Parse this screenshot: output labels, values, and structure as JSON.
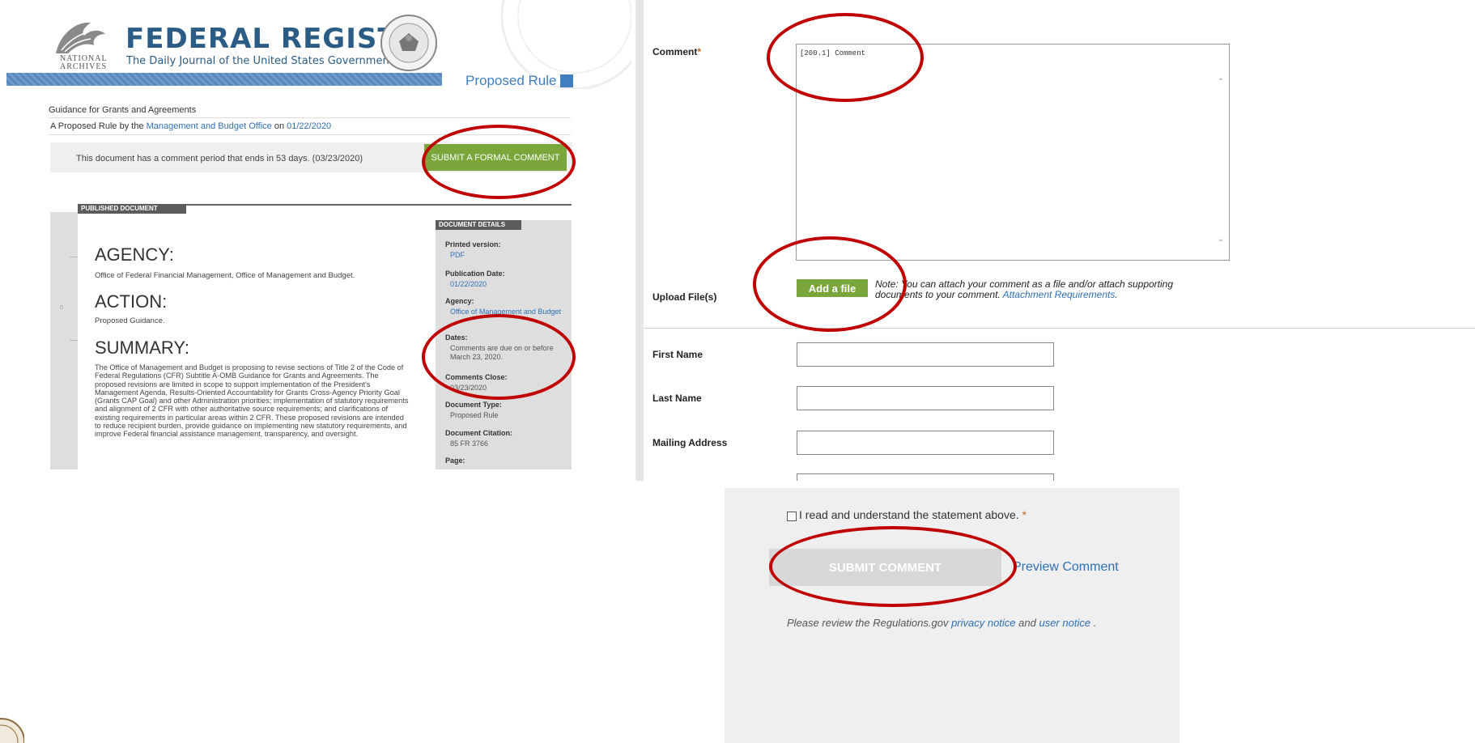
{
  "left": {
    "na_text": "NATIONAL\nARCHIVES",
    "title": "FEDERAL REGISTER",
    "subtitle": "The Daily Journal of the United States Government",
    "doc_type": "Proposed Rule",
    "doc_title": "Guidance for Grants and Agreements",
    "byline_prefix": "A Proposed Rule by the ",
    "byline_agency": "Management and Budget Office",
    "byline_on": " on ",
    "byline_date": "01/22/2020",
    "comment_period_text": "This document has a comment period that ends in 53 days. (03/23/2020)",
    "submit_formal_label": "SUBMIT A FORMAL COMMENT",
    "published_tab": "PUBLISHED DOCUMENT",
    "side_mark": "0",
    "agency_heading": "AGENCY:",
    "agency_text": "Office of Federal Financial Management, Office of Management and Budget.",
    "action_heading": "ACTION:",
    "action_text": "Proposed Guidance.",
    "summary_heading": "SUMMARY:",
    "summary_text": "The Office of Management and Budget is proposing to revise sections of Title 2 of the Code of Federal Regulations (CFR) Subtitle A-OMB Guidance for Grants and Agreements. The proposed revisions are limited in scope to support implementation of the President's Management Agenda, Results-Oriented Accountability for Grants Cross-Agency Priority Goal (Grants CAP Goal) and other Administration priorities; implementation of statutory requirements and alignment of 2 CFR with other authoritative source requirements; and clarifications of existing requirements in particular areas within 2 CFR. These proposed revisions are intended to reduce recipient burden, provide guidance on implementing new statutory requirements, and improve Federal financial assistance management, transparency, and oversight.",
    "details_tab": "DOCUMENT DETAILS",
    "details": [
      {
        "label": "Printed version:",
        "value": "PDF",
        "link": true
      },
      {
        "label": "Publication Date:",
        "value": "01/22/2020",
        "link": true
      },
      {
        "label": "Agency:",
        "value": "Office of Management and Budget",
        "link": true
      },
      {
        "label": "Dates:",
        "value": "Comments are due on or before March 23, 2020.",
        "link": false
      },
      {
        "label": "Comments Close:",
        "value": "03/23/2020",
        "link": false
      },
      {
        "label": "Document Type:",
        "value": "Proposed Rule",
        "link": false
      },
      {
        "label": "Document Citation:",
        "value": "85 FR 3766",
        "link": false
      },
      {
        "label": "Page:",
        "value": "",
        "link": false
      }
    ]
  },
  "right": {
    "comment_label": "Comment",
    "required_mark": "*",
    "comment_value": "[200.1] Comment",
    "upload_label": "Upload File(s)",
    "add_file_label": "Add a file",
    "note_prefix": "Note:",
    "note_text": " You can attach your comment as a file and/or attach supporting documents to your comment. ",
    "note_link": "Attachment Requirements",
    "note_end": ".",
    "first_name_label": "First Name",
    "last_name_label": "Last Name",
    "mailing_label": "Mailing Address"
  },
  "bottom": {
    "statement": "I read and understand the statement above.",
    "required_mark": "*",
    "submit_label": "SUBMIT COMMENT",
    "preview_label": "Preview Comment",
    "review_prefix": "Please review the Regulations.gov ",
    "privacy_link": "privacy notice",
    "review_and": " and ",
    "user_link": "user notice",
    "review_end": " ."
  },
  "colors": {
    "annotation": "#c00000",
    "green_button": "#7aa63b",
    "link": "#2f6fb5"
  }
}
